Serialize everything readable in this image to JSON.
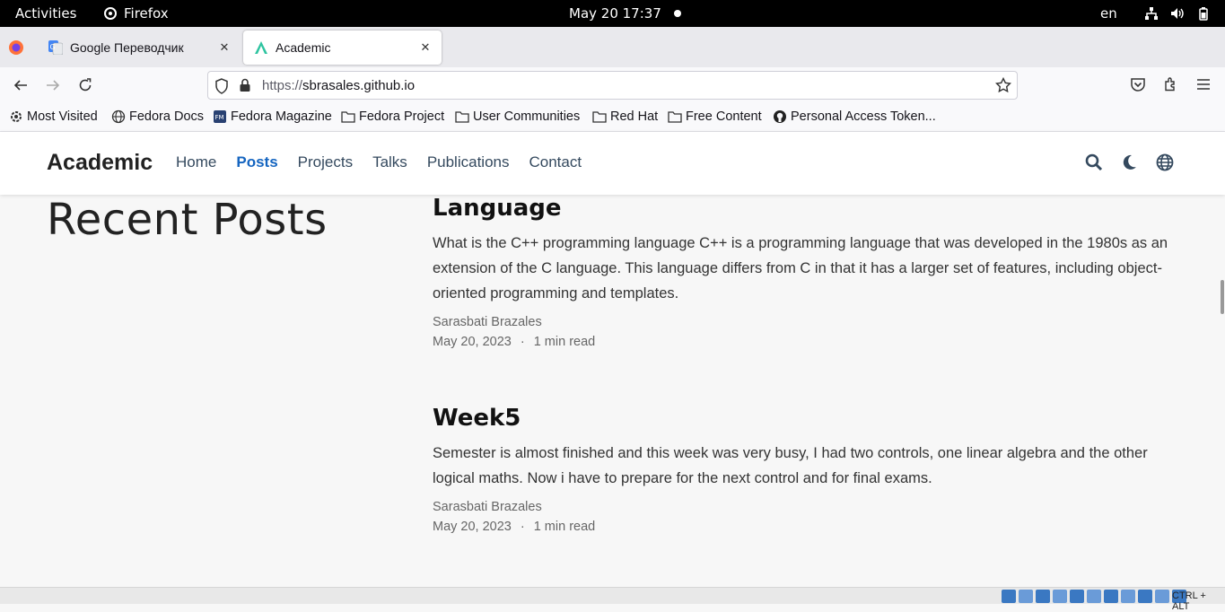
{
  "system_bar": {
    "activities": "Activities",
    "app_name": "Firefox",
    "clock": "May 20  17:37",
    "language": "en"
  },
  "tabs": [
    {
      "title": "Google Переводчик",
      "active": false
    },
    {
      "title": "Academic",
      "active": true
    }
  ],
  "address_bar": {
    "scheme": "https://",
    "host": "sbrasales.github.io"
  },
  "bookmarks": [
    {
      "label": "Most Visited",
      "icon": "gear-icon"
    },
    {
      "label": "Fedora Docs",
      "icon": "globe-icon"
    },
    {
      "label": "Fedora Magazine",
      "icon": "fedora-magazine-icon"
    },
    {
      "label": "Fedora Project",
      "icon": "folder-icon"
    },
    {
      "label": "User Communities",
      "icon": "folder-icon"
    },
    {
      "label": "Red Hat",
      "icon": "folder-icon"
    },
    {
      "label": "Free Content",
      "icon": "folder-icon"
    },
    {
      "label": "Personal Access Token...",
      "icon": "github-icon"
    }
  ],
  "site": {
    "brand": "Academic",
    "menu": [
      "Home",
      "Posts",
      "Projects",
      "Talks",
      "Publications",
      "Contact"
    ],
    "active_menu": "Posts",
    "accent_color": "#1565c0"
  },
  "page": {
    "heading": "Recent Posts",
    "posts": [
      {
        "title": "Language",
        "summary": "What is the C++ programming language C++ is a programming language that was developed in the 1980s as an extension of the C language. This language differs from C in that it has a larger set of features, including object-oriented programming and templates.",
        "author": "Sarasbati Brazales",
        "date": "May 20, 2023",
        "separator": "·",
        "read_time": "1 min read"
      },
      {
        "title": "Week5",
        "summary": "Semester is almost finished and this week was very busy, I had two controls, one linear algebra and the other logical maths. Now i have to prepare for the next control and for final exams.",
        "author": "Sarasbati Brazales",
        "date": "May 20, 2023",
        "separator": "·",
        "read_time": "1 min read"
      }
    ]
  },
  "status_bar": {
    "keys": "CTRL + ALT"
  }
}
